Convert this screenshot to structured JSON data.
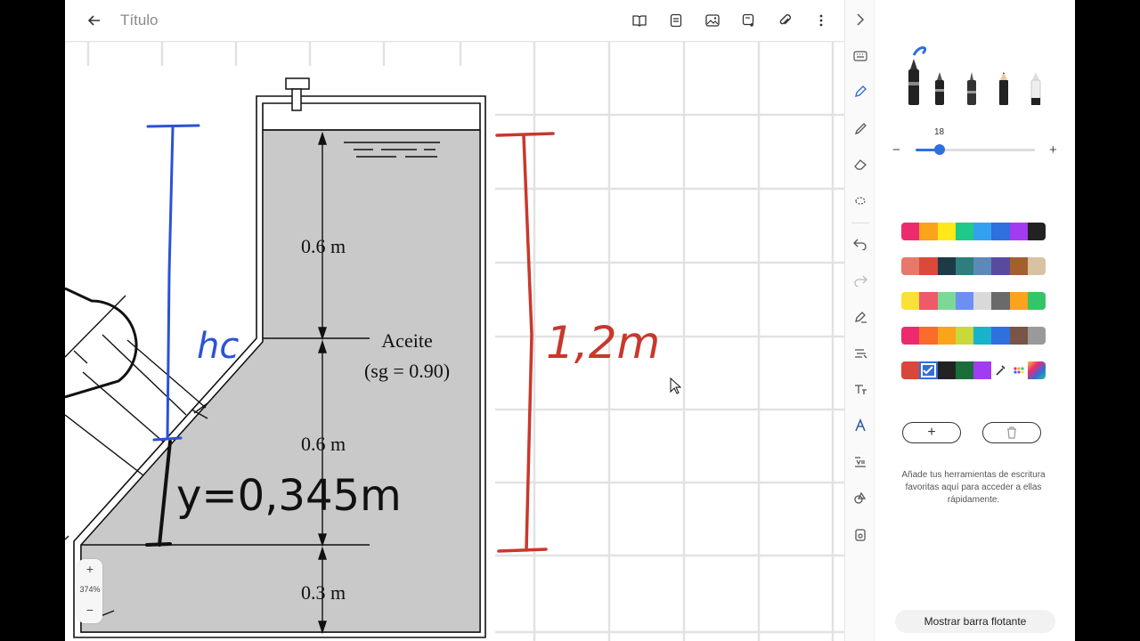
{
  "topbar": {
    "title": "Título",
    "icons": [
      "back-arrow-icon",
      "book-icon",
      "page-icon",
      "image-icon",
      "add-page-icon",
      "attach-icon",
      "more-icon"
    ]
  },
  "zoom": {
    "plus": "+",
    "level": "374%",
    "minus": "−"
  },
  "diagram": {
    "dim_top": "0.6 m",
    "dim_mid": "0.6 m",
    "dim_bottom": "0.3 m",
    "fluid_name": "Aceite",
    "fluid_sg": "(sg = 0.90)"
  },
  "handwriting": {
    "blue_label": "hc",
    "black_label": "y=0,345m",
    "red_label": "1,2m",
    "colors": {
      "blue": "#2b52d6",
      "red": "#c8382c",
      "black": "#111111"
    }
  },
  "toolrail": {
    "icons": [
      "chevron-right-icon",
      "keyboard-icon",
      "pen-icon",
      "highlighter-icon",
      "eraser-icon",
      "lasso-icon",
      "undo-icon",
      "redo-icon",
      "ink-to-shape-icon",
      "ruler-icon",
      "text-format-icon",
      "ink-text-icon",
      "math-icon",
      "shapes-icon",
      "replay-icon"
    ]
  },
  "panel": {
    "pens": [
      "fountain-pen",
      "ballpoint-pen",
      "fine-pen",
      "pencil",
      "highlighter-pen"
    ],
    "size_value": "18",
    "size_fraction": 0.2,
    "minus": "−",
    "plus": "+",
    "palettes": [
      [
        "#ee2a6f",
        "#fba31a",
        "#ffe81a",
        "#1fc989",
        "#33a1f0",
        "#2f6fde",
        "#a23cf0",
        "#222222"
      ],
      [
        "#e8786a",
        "#d94a3a",
        "#1d3a47",
        "#2f7d7d",
        "#5b8ab8",
        "#5a4a9e",
        "#a2602c",
        "#d8c2a2"
      ],
      [
        "#fbe039",
        "#ee5a6a",
        "#7ed895",
        "#6e8ff2",
        "#d9d9d9",
        "#6a6a6a",
        "#fba31a",
        "#36c46a"
      ],
      [
        "#ee2a6f",
        "#fb6c2b",
        "#fba31a",
        "#c9d83a",
        "#17b4c9",
        "#2f6fde",
        "#7a5446",
        "#9a9a9a"
      ],
      [
        "#d9473a",
        "#2f6fde",
        "#222222",
        "#1a6e3a",
        "#a23cf0",
        "eyedropper",
        "more-colors",
        "gradient"
      ]
    ],
    "selected_color_index": 1,
    "add_label": "+",
    "hint": "Añade tus herramientas de escritura favoritas aquí para acceder a ellas rápidamente.",
    "float_button": "Mostrar barra flotante"
  }
}
